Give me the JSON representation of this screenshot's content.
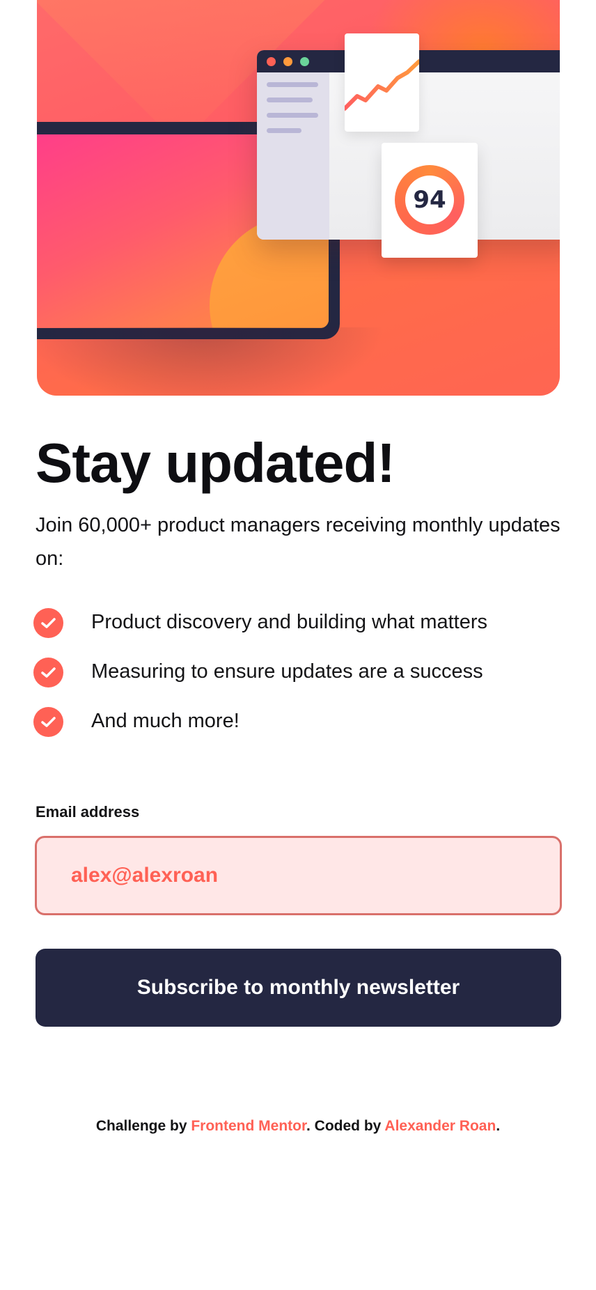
{
  "hero": {
    "score": "94"
  },
  "heading": "Stay updated!",
  "intro": "Join 60,000+ product managers receiving monthly updates on:",
  "features": [
    "Product discovery and building what matters",
    "Measuring to ensure updates are a success",
    "And much more!"
  ],
  "form": {
    "email_label": "Email address",
    "email_value": "alex@alexroan",
    "submit_label": "Subscribe to monthly newsletter"
  },
  "attribution": {
    "prefix": "Challenge by ",
    "challenge_link": "Frontend Mentor",
    "middle": ". Coded by ",
    "author_link": "Alexander Roan",
    "suffix": "."
  },
  "colors": {
    "accent": "#ff6155",
    "dark_navy": "#242742",
    "input_error_bg": "#ffe7e7"
  }
}
